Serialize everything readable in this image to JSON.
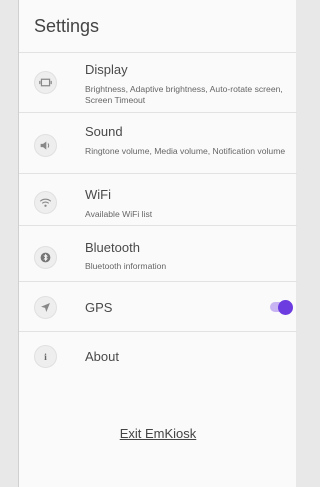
{
  "header": {
    "title": "Settings"
  },
  "items": [
    {
      "title": "Display",
      "desc": "Brightness, Adaptive brightness, Auto-rotate screen, Screen Timeout",
      "icon": "display-icon"
    },
    {
      "title": "Sound",
      "desc": "Ringtone volume, Media volume, Notification volume",
      "icon": "sound-icon"
    },
    {
      "title": "WiFi",
      "desc": "Available WiFi list",
      "icon": "wifi-icon"
    },
    {
      "title": "Bluetooth",
      "desc": "Bluetooth information",
      "icon": "bluetooth-icon"
    },
    {
      "title": "GPS",
      "desc": "",
      "icon": "location-icon",
      "toggle_on": true
    },
    {
      "title": "About",
      "desc": "",
      "icon": "info-icon"
    }
  ],
  "exit_label": "Exit EmKiosk",
  "colors": {
    "accent": "#6c3ce0",
    "accent_track": "#c8b4f2"
  }
}
